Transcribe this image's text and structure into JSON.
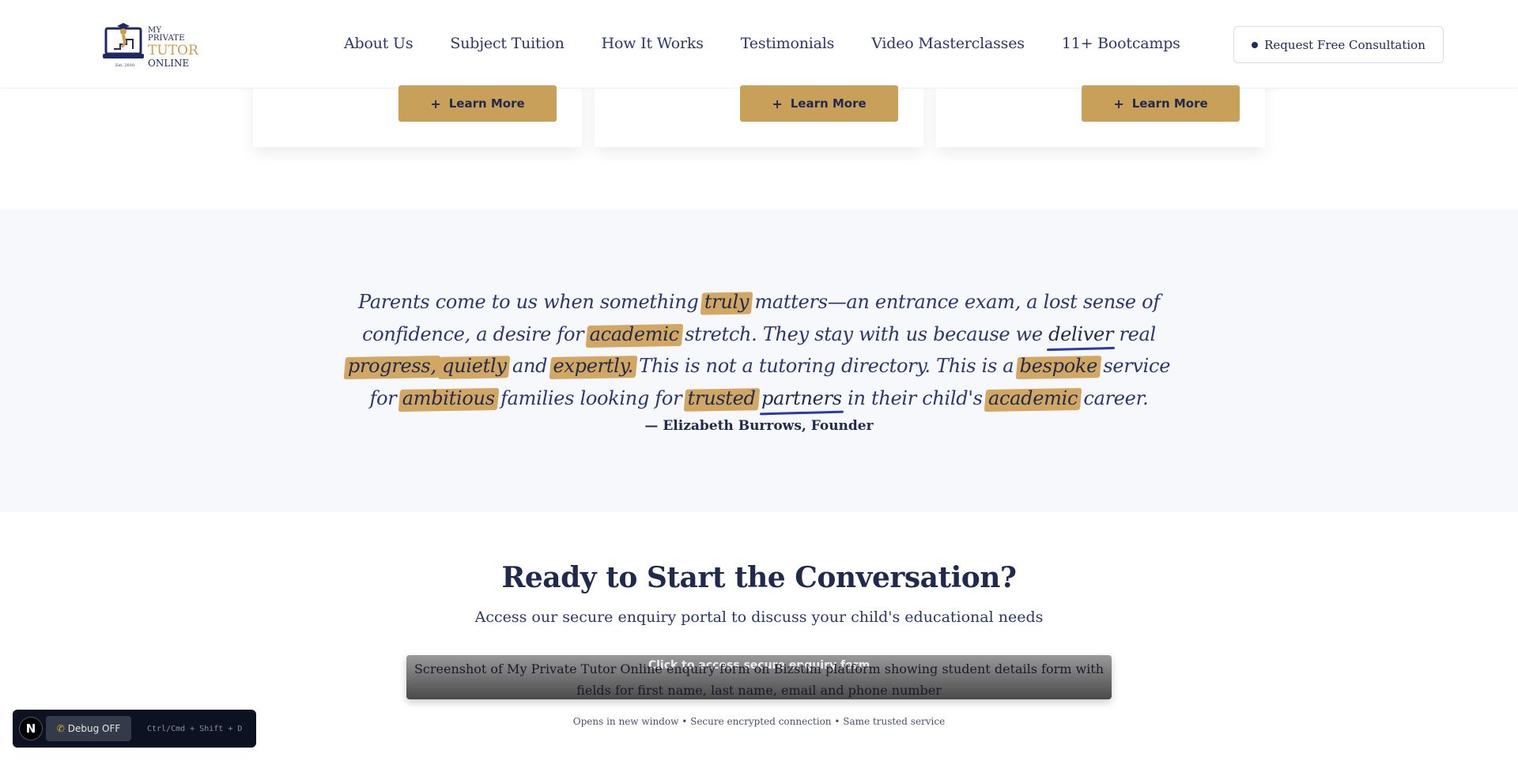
{
  "brand": {
    "line1": "MY PRIVATE",
    "line2": "TUTOR",
    "line3": "ONLINE",
    "est": "Est. 2010",
    "colors": {
      "navy": "#1f2a60",
      "gold": "#c9a04e"
    }
  },
  "nav": {
    "items": [
      "About Us",
      "Subject Tuition",
      "How It Works",
      "Testimonials",
      "Video Masterclasses",
      "11+ Bootcamps"
    ],
    "cta_label": "Request Free Consultation"
  },
  "cards": {
    "learn_more_label": "Learn More"
  },
  "quote": {
    "segments": [
      {
        "t": "Parents come to us when something ",
        "s": "plain"
      },
      {
        "t": "truly",
        "s": "hl"
      },
      {
        "t": " matters—an entrance exam, a lost sense of confidence, a desire for ",
        "s": "plain"
      },
      {
        "t": "academic",
        "s": "hl"
      },
      {
        "t": " stretch. They stay with us because we ",
        "s": "plain"
      },
      {
        "t": "deliver",
        "s": "ul"
      },
      {
        "t": " real ",
        "s": "plain"
      },
      {
        "t": "progress,",
        "s": "hl"
      },
      {
        "t": " ",
        "s": "plain"
      },
      {
        "t": "quietly",
        "s": "hl"
      },
      {
        "t": " and ",
        "s": "plain"
      },
      {
        "t": "expertly.",
        "s": "hl"
      },
      {
        "t": " This is not a tutoring directory. This is a ",
        "s": "plain"
      },
      {
        "t": "bespoke",
        "s": "hl"
      },
      {
        "t": " service for ",
        "s": "plain"
      },
      {
        "t": "ambitious",
        "s": "hl"
      },
      {
        "t": " families looking for ",
        "s": "plain"
      },
      {
        "t": "trusted",
        "s": "hl"
      },
      {
        "t": " ",
        "s": "plain"
      },
      {
        "t": "partners",
        "s": "ul"
      },
      {
        "t": " in their child's ",
        "s": "plain"
      },
      {
        "t": "academic",
        "s": "hl"
      },
      {
        "t": " career.",
        "s": "plain"
      }
    ],
    "attribution": "— Elizabeth Burrows, Founder",
    "highlight_color": "#d2a763",
    "underline_color": "#2a3aa8"
  },
  "contact": {
    "title": "Ready to Start the Conversation?",
    "subtitle": "Access our secure enquiry portal to discuss your child's educational needs",
    "portal_image_alt": "Screenshot of My Private Tutor Online enquiry form on Bizstim platform showing student details form with fields for first name, last name, email and phone number",
    "portal_overlay": "Click to access secure enquiry form",
    "note": "Opens in new window • Secure encrypted connection • Same trusted service"
  },
  "debug": {
    "logo_letter": "N",
    "toggle_label": "Debug OFF",
    "shortcut": "Ctrl/Cmd + Shift + D"
  }
}
